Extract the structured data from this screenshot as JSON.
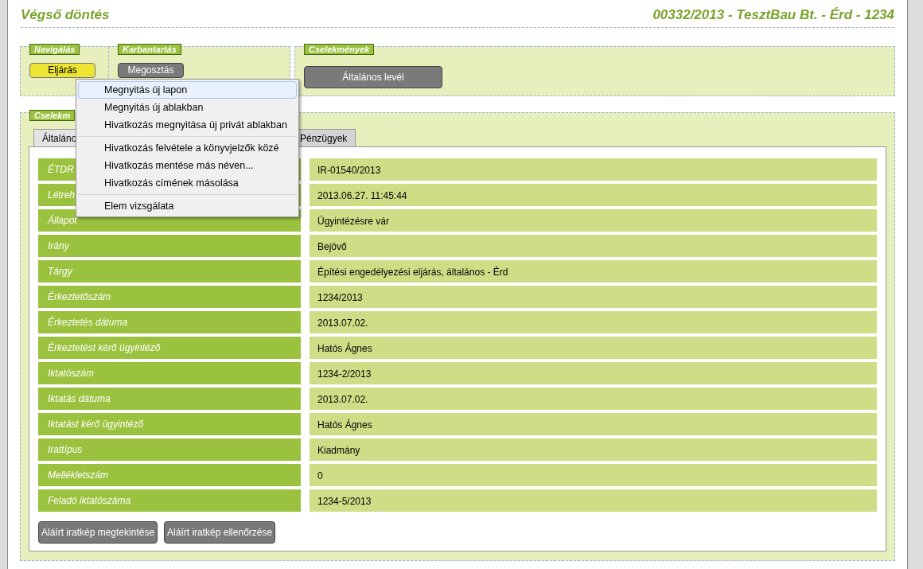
{
  "header": {
    "title": "Végső döntés",
    "case": "00332/2013 - TesztBau Bt. - Érd - 1234"
  },
  "panels": [
    {
      "legend": "Navigálás",
      "buttons": [
        {
          "label": "Eljárás",
          "kind": "primary"
        }
      ]
    },
    {
      "legend": "Karbantartás",
      "buttons": [
        {
          "label": "Megosztás",
          "kind": "secondary"
        }
      ]
    },
    {
      "legend": "Cselekmények",
      "buttons": [
        {
          "label": "Általános levél",
          "kind": "secondary"
        }
      ]
    }
  ],
  "details": {
    "legend": "Cselekm",
    "tabs": [
      {
        "label": "Általáno",
        "selected": true
      },
      {
        "label": "Pénzügyek",
        "selected": false
      }
    ],
    "rows": [
      {
        "label": "ÉTDR",
        "value": "IR-01540/2013"
      },
      {
        "label": "Létreh",
        "value": "2013.06.27. 11:45:44"
      },
      {
        "label": "Állapot",
        "value": "Ügyintézésre vár"
      },
      {
        "label": "Irány",
        "value": "Bejövő"
      },
      {
        "label": "Tárgy",
        "value": "Építési engedélyezési eljárás, általános - Érd"
      },
      {
        "label": "Érkeztetőszám",
        "value": "1234/2013"
      },
      {
        "label": "Érkeztetés dátuma",
        "value": "2013.07.02."
      },
      {
        "label": "Érkeztetést kérő ügyintéző",
        "value": "Hatós Ágnes"
      },
      {
        "label": "Iktatószám",
        "value": "1234-2/2013"
      },
      {
        "label": "Iktatás dátuma",
        "value": "2013.07.02."
      },
      {
        "label": "Iktatást kérő ügyintéző",
        "value": "Hatós Ágnes"
      },
      {
        "label": "Irattípus",
        "value": "Kiadmány"
      },
      {
        "label": "Mellékletszám",
        "value": "0"
      },
      {
        "label": "Feladó iktatószáma",
        "value": "1234-5/2013"
      }
    ],
    "buttons": [
      "Aláírt iratkép megtekintése",
      "Aláírt iratkép ellenőrzése"
    ]
  },
  "context_menu": {
    "groups": [
      [
        {
          "label": "Megnyitás új lapon",
          "selected": true
        },
        {
          "label": "Megnyitás új ablakban",
          "selected": false
        },
        {
          "label": "Hivatkozás megnyitása új privát ablakban",
          "selected": false
        }
      ],
      [
        {
          "label": "Hivatkozás felvétele a könyvjelzők közé",
          "selected": false
        },
        {
          "label": "Hivatkozás mentése más néven...",
          "selected": false
        },
        {
          "label": "Hivatkozás címének másolása",
          "selected": false
        }
      ],
      [
        {
          "label": "Elem vizsgálata",
          "selected": false
        }
      ]
    ]
  }
}
